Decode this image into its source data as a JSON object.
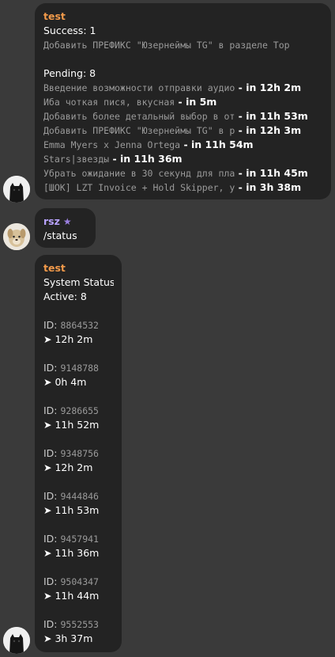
{
  "colors": {
    "background": "#3a3a3a",
    "bubble": "#232323",
    "sender_orange": "#f29a4a",
    "sender_purple": "#b9a3ff",
    "monospace_gray": "#9a9a9a"
  },
  "message1": {
    "sender": "test",
    "success_label": "Success: 1",
    "success_items": [
      "Добавить ПРЕФИКС \"Юзернеймы TG\" в разделе Тор"
    ],
    "pending_label": "Pending: 8",
    "pending_items": [
      {
        "text": "Введение возможности отправки аудио",
        "eta": " - in 12h 2m"
      },
      {
        "text": "Иба чоткая пися, вкусная",
        "eta": " - in 5m"
      },
      {
        "text": "Добавить более детальный выбор в от",
        "eta": " - in 11h 53m"
      },
      {
        "text": "Добавить ПРЕФИКС \"Юзернеймы TG\" в р",
        "eta": " - in 12h 3m"
      },
      {
        "text": "Emma Myers x Jenna Ortega",
        "eta": " - in 11h 54m"
      },
      {
        "text": "Stars|звезды",
        "eta": " - in 11h 36m"
      },
      {
        "text": "Убрать ожидание в 30 секунд для пла",
        "eta": " - in 11h 45m"
      },
      {
        "text": "[ШОК] LZT Invoice + Hold Skipper, у",
        "eta": " - in 3h 38m"
      }
    ]
  },
  "message2": {
    "sender": "rsz",
    "badge_icon": "star-icon",
    "text": "/status"
  },
  "message3": {
    "sender": "test",
    "title": "System Status",
    "active": "Active: 8",
    "id_label": "ID: ",
    "entries": [
      {
        "id": "8864532",
        "time": "➤ 12h 2m"
      },
      {
        "id": "9148788",
        "time": "➤ 0h 4m"
      },
      {
        "id": "9286655",
        "time": "➤ 11h 52m"
      },
      {
        "id": "9348756",
        "time": "➤ 12h 2m"
      },
      {
        "id": "9444846",
        "time": "➤ 11h 53m"
      },
      {
        "id": "9457941",
        "time": "➤ 11h 36m"
      },
      {
        "id": "9504347",
        "time": "➤ 11h 44m"
      },
      {
        "id": "9552553",
        "time": "➤ 3h 37m"
      }
    ]
  }
}
